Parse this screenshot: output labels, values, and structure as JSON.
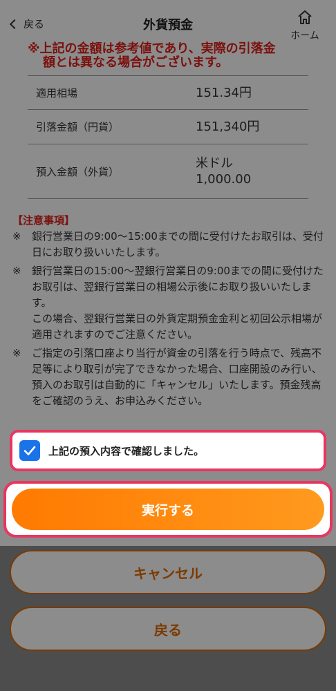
{
  "header": {
    "back_label": "戻る",
    "title": "外貨預金",
    "home_label": "ホーム"
  },
  "warning": {
    "line1": "※上記の金額は参考値であり、実際の引落金",
    "line2": "額とは異なる場合がございます。"
  },
  "rate_table": [
    {
      "label": "適用相場",
      "value": "151.34円"
    },
    {
      "label": "引落金額（円貨）",
      "value": "151,340円"
    },
    {
      "label": "預入金額（外貨）",
      "value": "米ドル\n1,000.00"
    }
  ],
  "notes": {
    "title": "【注意事項】",
    "mark": "※",
    "items": [
      "銀行営業日の9:00～15:00までの間に受付けたお取引は、受付日にお取り扱いいたします。",
      "銀行営業日の15:00～翌銀行営業日の9:00までの間に受付けたお取引は、翌銀行営業日の相場公示後にお取り扱いいたします。\nこの場合、翌銀行営業日の外貨定期預金金利と初回公示相場が適用されますのでご注意ください。",
      "ご指定の引落口座より当行が資金の引落を行う時点で、残高不足等により取引が完了できなかった場合、口座開設のみ行い、預入のお取引は自動的に「キャンセル」いたします。預金残高をご確認のうえ、お申込みください。"
    ]
  },
  "confirm": {
    "label": "上記の預入内容で確認しました。",
    "checked": true
  },
  "buttons": {
    "execute": "実行する",
    "cancel": "キャンセル",
    "back": "戻る"
  },
  "colors": {
    "accent_orange": "#ff8a00",
    "warning_red": "#e0201b",
    "highlight_pink": "#e8365f",
    "checkbox_blue": "#1a74e8"
  }
}
